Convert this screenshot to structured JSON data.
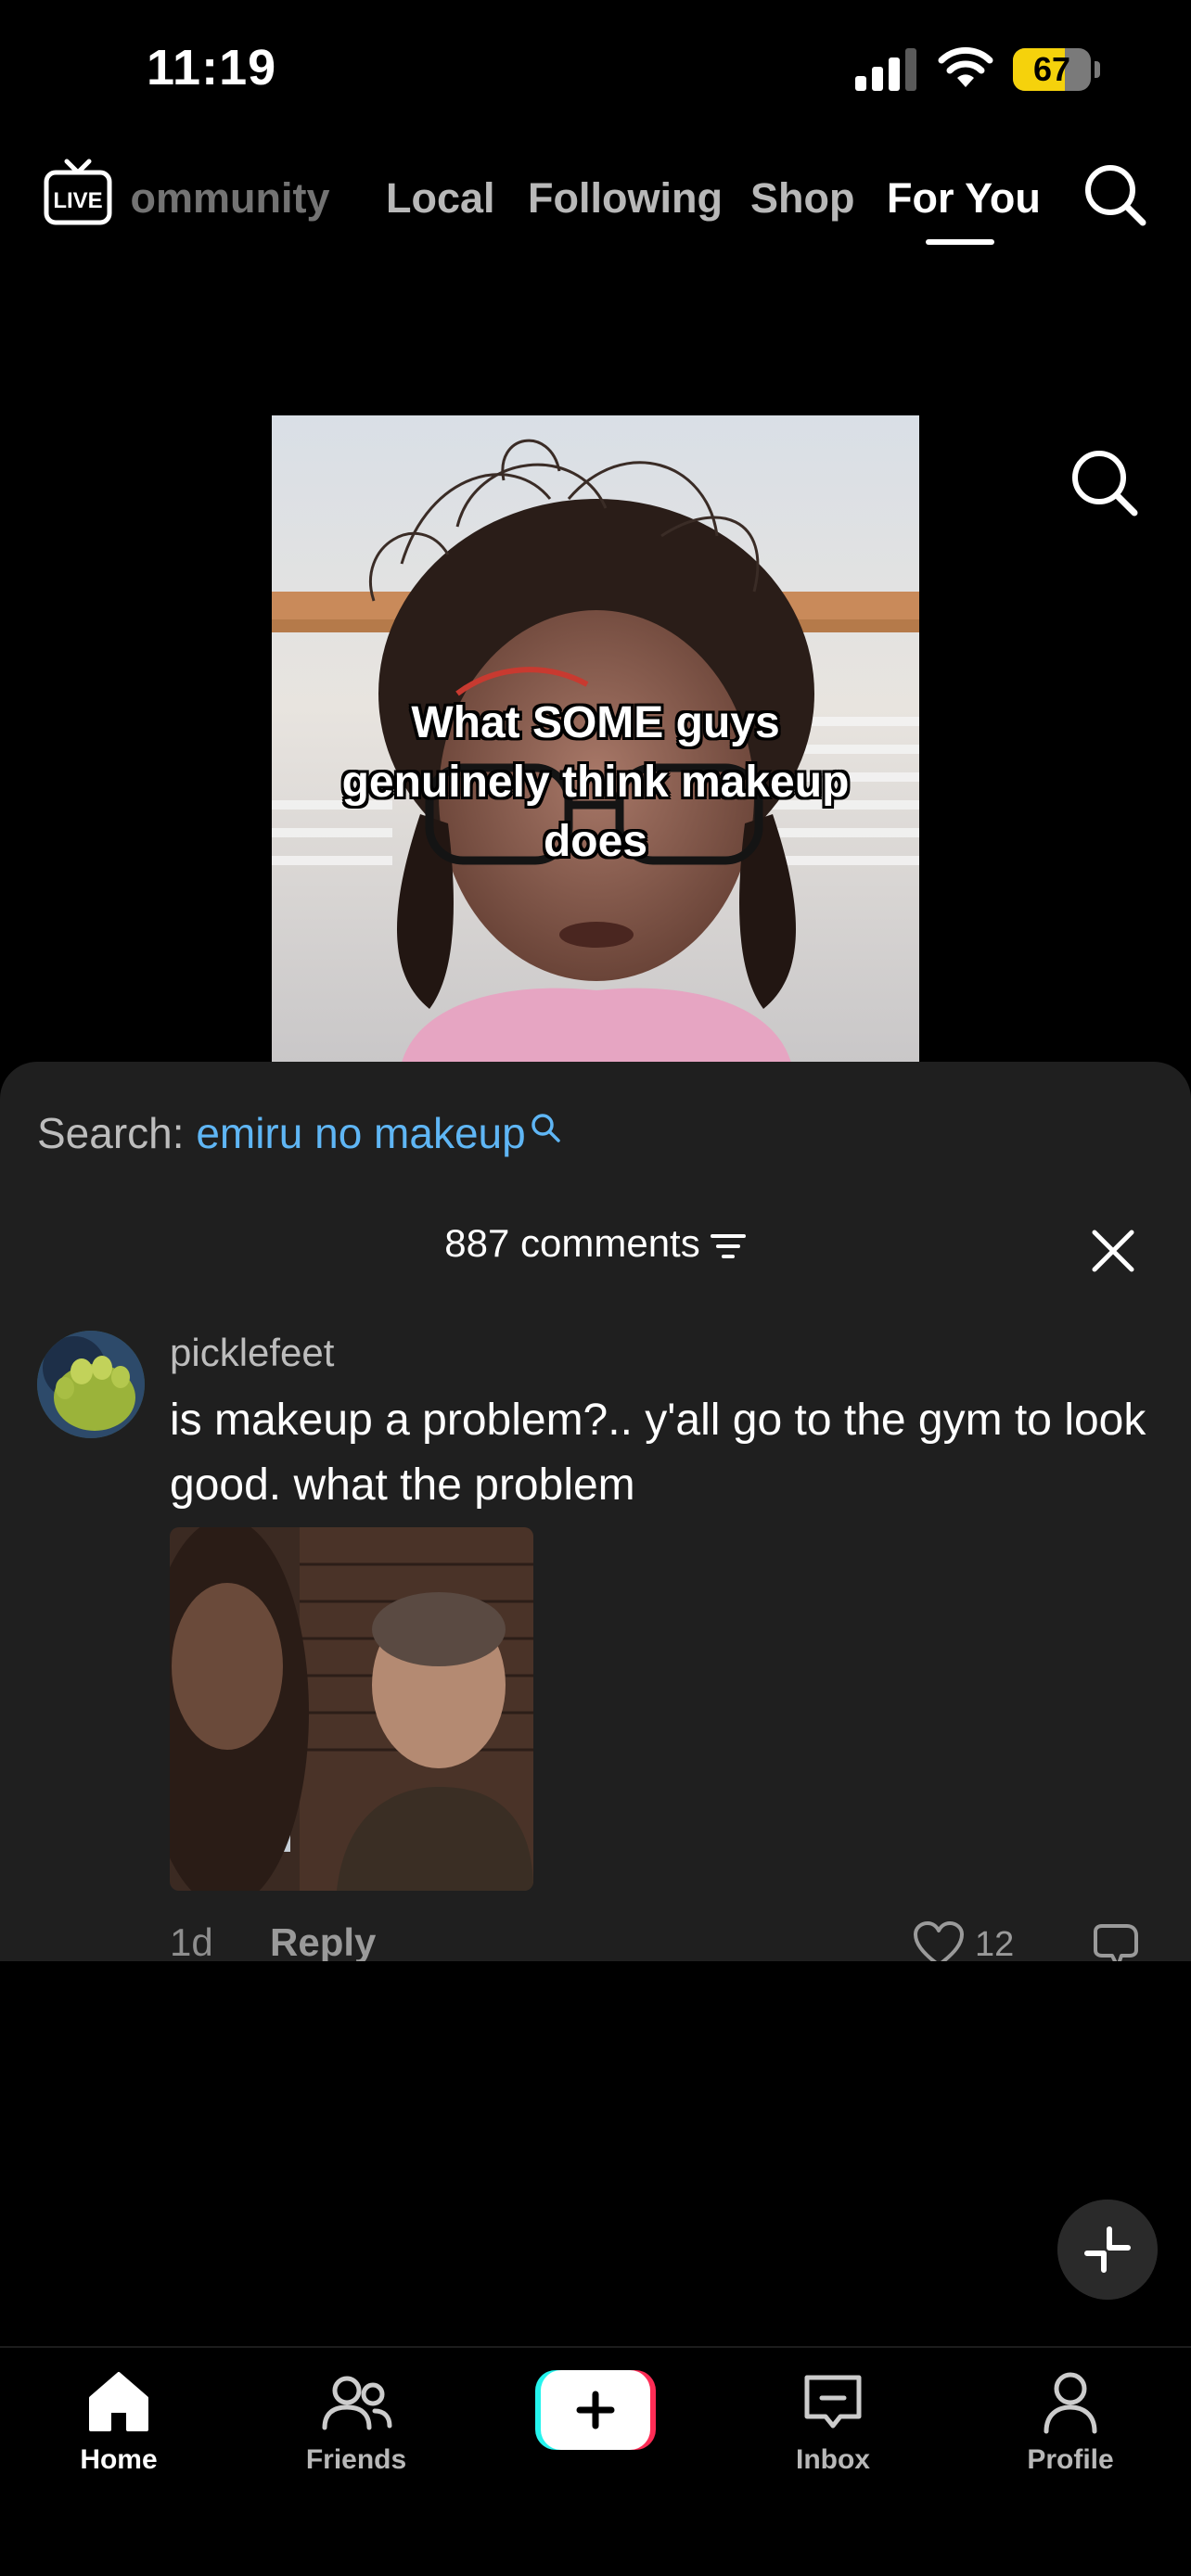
{
  "status_bar": {
    "time": "11:19",
    "battery_level": "67",
    "battery_fraction": 0.67
  },
  "top_nav": {
    "tabs": [
      {
        "label": "Community"
      },
      {
        "label": "Local"
      },
      {
        "label": "Following"
      },
      {
        "label": "Shop"
      },
      {
        "label": "For You"
      }
    ],
    "active_tab": "For You",
    "live_label": "LIVE"
  },
  "video": {
    "caption": "What SOME guys genuinely think makeup does"
  },
  "comments_sheet": {
    "search_prefix": "Search: ",
    "search_query": "emiru no makeup",
    "count_label": "887 comments",
    "comment": {
      "username": "picklefeet",
      "text": "is makeup a problem?.. y'all go to the gym to look good. what the problem",
      "age": "1d",
      "reply_label": "Reply",
      "likes": "12"
    }
  },
  "bottom_nav": {
    "items": [
      {
        "label": "Home"
      },
      {
        "label": "Friends"
      },
      {
        "label": "Inbox"
      },
      {
        "label": "Profile"
      }
    ]
  },
  "colors": {
    "accent_query": "#5fb6f5",
    "battery": "#f5d20c",
    "sheet_bg": "#1f1f1f",
    "create_cyan": "#25f4ee",
    "create_red": "#fe2c55"
  },
  "icons": [
    "signal-icon",
    "wifi-icon",
    "battery-icon",
    "live-tv-icon",
    "search-icon",
    "filter-icon",
    "close-icon",
    "heart-icon",
    "dislike-icon",
    "collapse-icon",
    "home-icon",
    "friends-icon",
    "plus-icon",
    "inbox-icon",
    "profile-icon"
  ]
}
